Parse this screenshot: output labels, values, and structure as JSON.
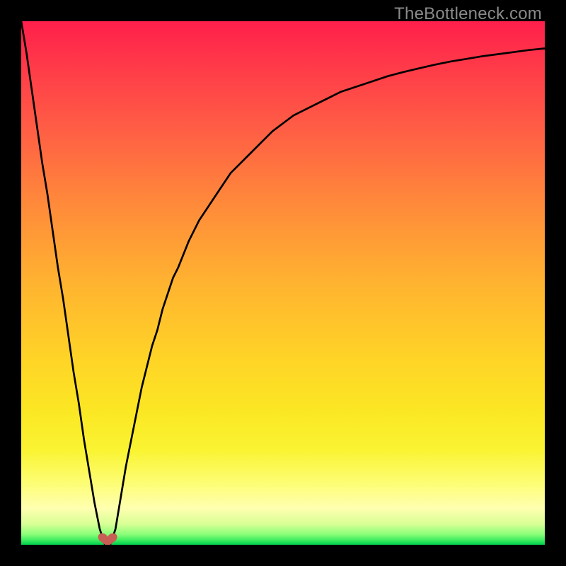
{
  "watermark": {
    "text": "TheBottleneck.com"
  },
  "chart_data": {
    "type": "line",
    "title": "",
    "xlabel": "",
    "ylabel": "",
    "xlim": [
      0,
      100
    ],
    "ylim": [
      0,
      100
    ],
    "x": [
      0,
      1,
      2,
      3,
      4,
      5,
      6,
      7,
      8,
      9,
      10,
      11,
      12,
      13,
      14,
      15,
      16,
      17,
      18,
      19,
      20,
      21,
      22,
      23,
      24,
      25,
      26,
      27,
      28,
      29,
      30,
      32,
      34,
      36,
      38,
      40,
      42,
      44,
      46,
      48,
      50,
      52,
      55,
      58,
      61,
      64,
      67,
      70,
      73,
      76,
      79,
      82,
      85,
      88,
      91,
      94,
      97,
      100
    ],
    "y": [
      100,
      94,
      87,
      80,
      73,
      67,
      60,
      53,
      47,
      40,
      33,
      27,
      20,
      14,
      8,
      3,
      0,
      0,
      3,
      9,
      15,
      20,
      25,
      30,
      34,
      38,
      41,
      45,
      48,
      51,
      53,
      58,
      62,
      65,
      68,
      71,
      73,
      75,
      77,
      79,
      80.5,
      82,
      83.5,
      85,
      86.5,
      87.5,
      88.5,
      89.5,
      90.3,
      91,
      91.7,
      92.3,
      92.8,
      93.3,
      93.7,
      94.1,
      94.5,
      94.8
    ],
    "marker": {
      "x": 16.5,
      "y": 0,
      "shape": "heart",
      "color": "#c85f54"
    },
    "gradient_colors": {
      "top": "#ff1f4b",
      "mid": "#ffd526",
      "bottom": "#00cf4e"
    }
  }
}
